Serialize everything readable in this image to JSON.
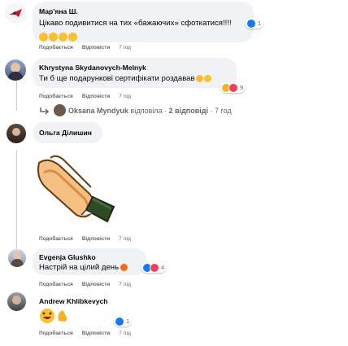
{
  "comments": [
    {
      "author": "Мар'яна Ш.",
      "text": "Цікаво подивитися на тих «бажаючих» сфоткатися!!!!",
      "reaction_count": "1",
      "time": "7 год"
    },
    {
      "author": "Khrystyna Skydanovych-Melnyk",
      "text": "Ти б ще подарункові сертифікати роздавав",
      "reaction_count": "9",
      "time": "7 год",
      "replies_summary": {
        "name": "Oksana Myndyuk",
        "action": "відповіла",
        "sep": "·",
        "count": "2 відповіді",
        "time": "7 год"
      }
    },
    {
      "author": "Ольга Ділишин",
      "image": "clapping-hands-sticker",
      "time": "7 год"
    },
    {
      "author": "Evgenja Glushko",
      "text": "Настрій на цілий день",
      "reaction_count": "4",
      "time": "7 год"
    },
    {
      "author": "Andrew Khlibkevych",
      "reaction_count": "1",
      "time": "7 год"
    }
  ],
  "actions": {
    "like": "Подобається",
    "reply": "Відповісти"
  },
  "colors": {
    "like": "#1877f2",
    "love": "#f33e58",
    "haha": "#f7b125",
    "bubble": "#f0f2f5",
    "meta": "#65676b"
  }
}
